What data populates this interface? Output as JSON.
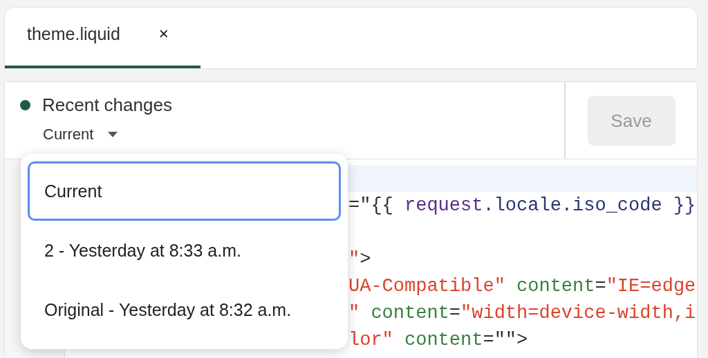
{
  "tabs": [
    {
      "label": "theme.liquid",
      "close": "×",
      "selected": true
    }
  ],
  "header": {
    "title": "Recent changes",
    "version": "Current"
  },
  "save_button": {
    "label": "Save",
    "disabled": true
  },
  "code_lines": [
    {
      "active": true
    },
    {
      "active": false,
      "segments": [
        {
          "kind": "punct",
          "text": "=\"{{ "
        },
        {
          "kind": "keyword",
          "text": "request"
        },
        {
          "kind": "var",
          "text": ".locale.iso_code }}"
        }
      ]
    },
    {
      "active": false
    },
    {
      "active": false,
      "segments": [
        {
          "kind": "string",
          "text": "\""
        },
        {
          "kind": "punct",
          "text": ">"
        }
      ]
    },
    {
      "active": false,
      "segments": [
        {
          "kind": "string",
          "text": "UA-Compatible\" "
        },
        {
          "kind": "attr",
          "text": "content"
        },
        {
          "kind": "punct",
          "text": "="
        },
        {
          "kind": "string",
          "text": "\"IE=edge"
        }
      ]
    },
    {
      "active": false,
      "segments": [
        {
          "kind": "string",
          "text": "\" "
        },
        {
          "kind": "attr",
          "text": "content"
        },
        {
          "kind": "punct",
          "text": "="
        },
        {
          "kind": "string",
          "text": "\"width=device-width,i"
        }
      ]
    },
    {
      "active": false,
      "segments": [
        {
          "kind": "string",
          "text": "lor\" "
        },
        {
          "kind": "attr",
          "text": "content"
        },
        {
          "kind": "punct",
          "text": "=\"\">"
        }
      ]
    }
  ],
  "version_menu": {
    "items": [
      {
        "label": "Current",
        "selected": true
      },
      {
        "label": "2 - Yesterday at 8:33 a.m.",
        "selected": false
      },
      {
        "label": "Original - Yesterday at 8:32 a.m.",
        "selected": false
      }
    ]
  }
}
